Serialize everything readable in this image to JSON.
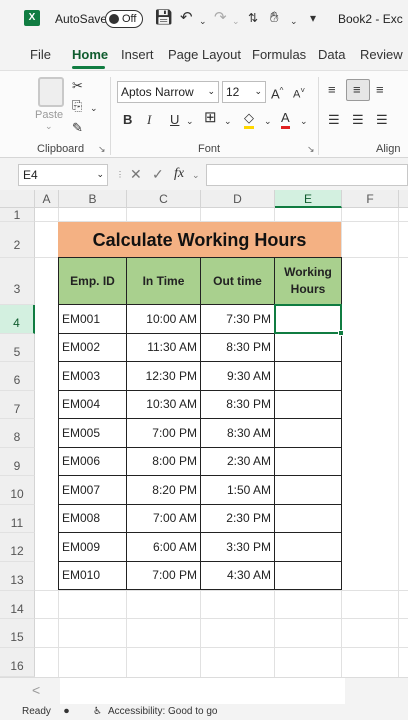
{
  "titlebar": {
    "app_badge": "X",
    "autosave_label": "AutoSave",
    "autosave_state": "Off",
    "book_title": "Book2 - Exc"
  },
  "tabs": [
    "File",
    "Home",
    "Insert",
    "Page Layout",
    "Formulas",
    "Data",
    "Review"
  ],
  "active_tab": "Home",
  "ribbon": {
    "paste_label": "Paste",
    "clipboard_label": "Clipboard",
    "font_name": "Aptos Narrow",
    "font_size": "12",
    "font_label": "Font",
    "alignment_label": "Align",
    "bold": "B",
    "italic": "I",
    "underline": "U",
    "grow_font": "A",
    "shrink_font": "A",
    "font_color_glyph": "A"
  },
  "formula_bar": {
    "name_box": "E4",
    "cancel_glyph": "✕",
    "enter_glyph": "✓",
    "fx_label": "fx",
    "formula": ""
  },
  "grid": {
    "columns": [
      "A",
      "B",
      "C",
      "D",
      "E",
      "F"
    ],
    "selected_column": "E",
    "rows": [
      "1",
      "2",
      "3",
      "4",
      "5",
      "6",
      "7",
      "8",
      "9",
      "10",
      "11",
      "12",
      "13",
      "14",
      "15",
      "16"
    ],
    "selected_row": "4",
    "title": "Calculate Working Hours",
    "headers": [
      "Emp. ID",
      "In Time",
      "Out time",
      "Working Hours"
    ],
    "records": [
      [
        "EM001",
        "10:00 AM",
        "7:30 PM",
        ""
      ],
      [
        "EM002",
        "11:30 AM",
        "8:30 PM",
        ""
      ],
      [
        "EM003",
        "12:30 PM",
        "9:30 AM",
        ""
      ],
      [
        "EM004",
        "10:30 AM",
        "8:30 PM",
        ""
      ],
      [
        "EM005",
        "7:00 PM",
        "8:30 AM",
        ""
      ],
      [
        "EM006",
        "8:00 PM",
        "2:30 AM",
        ""
      ],
      [
        "EM007",
        "8:20 PM",
        "1:50 AM",
        ""
      ],
      [
        "EM008",
        "7:00 AM",
        "2:30 PM",
        ""
      ],
      [
        "EM009",
        "6:00 AM",
        "3:30 PM",
        ""
      ],
      [
        "EM010",
        "7:00 PM",
        "4:30 AM",
        ""
      ]
    ]
  },
  "sheetbar": {
    "prev_arrow": "<"
  },
  "status": {
    "ready": "Ready",
    "accessibility": "Accessibility: Good to go"
  },
  "colors": {
    "excel_green": "#107c41",
    "title_fill": "#f4b183",
    "header_fill": "#a9d08e"
  }
}
